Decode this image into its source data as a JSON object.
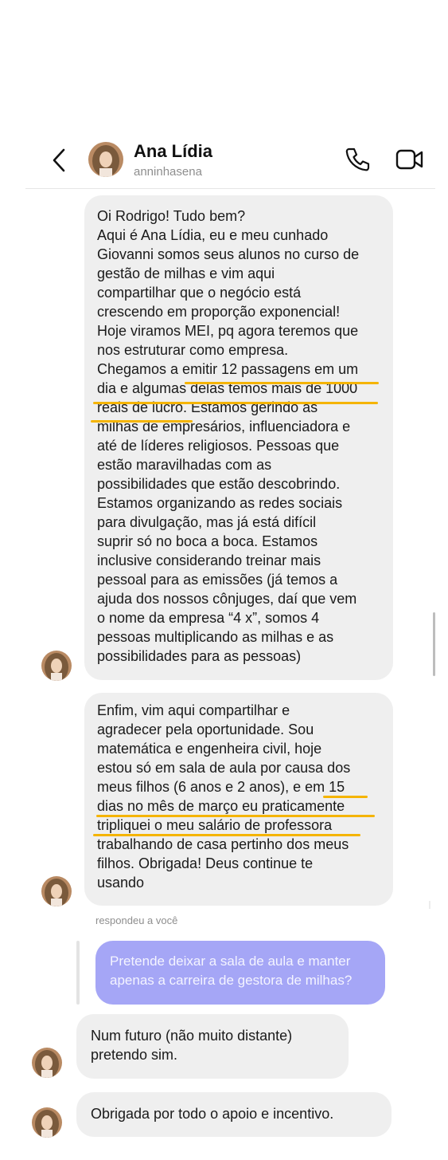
{
  "header": {
    "name": "Ana Lídia",
    "handle": "anninhasena"
  },
  "messages": [
    {
      "text": "Oi Rodrigo! Tudo bem?\nAqui é Ana Lídia, eu e meu cunhado\nGiovanni somos seus alunos no curso de\ngestão de milhas e vim aqui\ncompartilhar que o negócio está\ncrescendo em proporção exponencial!\nHoje viramos MEI, pq agora teremos que\nnos estruturar como empresa.\nChegamos a emitir 12 passagens em um\ndia e algumas delas temos mais de 1000\nreais de lucro. Estamos gerindo as\nmilhas de empresários, influenciadora e\naté de líderes religiosos. Pessoas que\nestão maravilhadas com as\npossibilidades que estão descobrindo.\nEstamos organizando as redes sociais\npara divulgação, mas já está difícil\nsuprir só no boca a boca. Estamos\ninclusive considerando treinar mais\npessoal para as emissões (já temos a\najuda dos nossos cônjuges, daí que vem\no nome da empresa “4 x”, somos 4\npessoas multiplicando as milhas e as\npossibilidades para as pessoas)"
    },
    {
      "text": "Enfim, vim aqui compartilhar e\nagradecer pela oportunidade. Sou\nmatemática e engenheira civil, hoje\nestou só em sala de aula por causa dos\nmeus filhos (6 anos e 2 anos), e em 15\ndias no mês de março eu praticamente\ntripliquei o meu salário de professora\ntrabalhando de casa pertinho dos meus\nfilhos. Obrigada! Deus continue te\nusando"
    }
  ],
  "reply": {
    "note": "respondeu a você",
    "text": "Pretende deixar a sala de aula e manter\napenas a carreira de gestora de milhas?"
  },
  "answers": [
    {
      "text": "Num futuro (não muito distante)\npretendo sim."
    },
    {
      "text": "Obrigada por todo o apoio e incentivo."
    }
  ],
  "colors": {
    "highlight": "#f5b400",
    "outgoing_bubble": "#a5a6f6",
    "incoming_bubble": "#efefef"
  },
  "icons": [
    "back-icon",
    "phone-icon",
    "video-call-icon",
    "avatar"
  ]
}
